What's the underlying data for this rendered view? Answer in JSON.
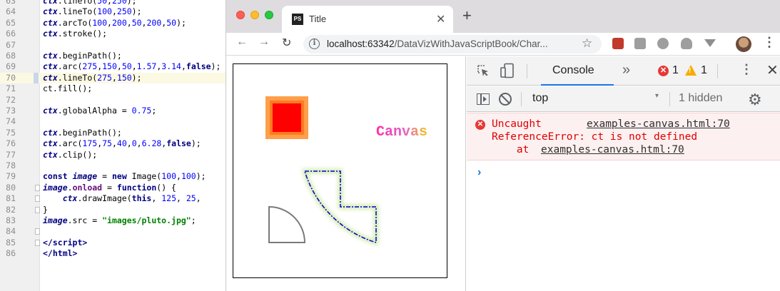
{
  "editor": {
    "lines": [
      {
        "num": "63",
        "html": "<span class='tk-v'>ctx</span>.lineTo(<span class='tk-n'>50</span>,<span class='tk-n'>250</span>);"
      },
      {
        "num": "64",
        "html": "<span class='tk-v'>ctx</span>.lineTo(<span class='tk-n'>100</span>,<span class='tk-n'>250</span>);"
      },
      {
        "num": "65",
        "html": "<span class='tk-v'>ctx</span>.arcTo(<span class='tk-n'>100</span>,<span class='tk-n'>200</span>,<span class='tk-n'>50</span>,<span class='tk-n'>200</span>,<span class='tk-n'>50</span>);"
      },
      {
        "num": "66",
        "html": "<span class='tk-v'>ctx</span>.stroke();"
      },
      {
        "num": "67",
        "html": ""
      },
      {
        "num": "68",
        "html": "<span class='tk-v'>ctx</span>.beginPath();"
      },
      {
        "num": "69",
        "html": "<span class='tk-v'>ctx</span>.arc(<span class='tk-n'>275</span>,<span class='tk-n'>150</span>,<span class='tk-n'>50</span>,<span class='tk-n'>1.57</span>,<span class='tk-n'>3.14</span>,<span class='tk-k'>false</span>);"
      },
      {
        "num": "70",
        "html": "<span class='tk-v'>ctx</span>.lineTo(<span class='tk-n'>275</span>,<span class='tk-n'>150</span>);"
      },
      {
        "num": "71",
        "html": "ct.fill();"
      },
      {
        "num": "72",
        "html": ""
      },
      {
        "num": "73",
        "html": "<span class='tk-v'>ctx</span>.globalAlpha = <span class='tk-n'>0.75</span>;"
      },
      {
        "num": "74",
        "html": ""
      },
      {
        "num": "75",
        "html": "<span class='tk-v'>ctx</span>.beginPath();"
      },
      {
        "num": "76",
        "html": "<span class='tk-v'>ctx</span>.arc(<span class='tk-n'>175</span>,<span class='tk-n'>75</span>,<span class='tk-n'>40</span>,<span class='tk-n'>0</span>,<span class='tk-n'>6.28</span>,<span class='tk-k'>false</span>);"
      },
      {
        "num": "77",
        "html": "<span class='tk-v'>ctx</span>.clip();"
      },
      {
        "num": "78",
        "html": ""
      },
      {
        "num": "79",
        "html": "<span class='tk-k'>const</span> <span class='tk-v'>image</span> = <span class='tk-k'>new</span> Image(<span class='tk-n'>100</span>,<span class='tk-n'>100</span>);"
      },
      {
        "num": "80",
        "html": "<span class='tk-v'>image</span>.<span class='tk-m'>onload</span> = <span class='tk-k'>function</span>() {"
      },
      {
        "num": "81",
        "html": "    <span class='tk-v'>ctx</span>.drawImage(<span class='tk-k'>this</span>, <span class='tk-n'>125</span>, <span class='tk-n'>25</span>,"
      },
      {
        "num": "82",
        "html": "}"
      },
      {
        "num": "83",
        "html": "<span class='tk-v'>image</span>.src = <span class='tk-s'>\"images/pluto.jpg\"</span>;"
      },
      {
        "num": "84",
        "html": ""
      },
      {
        "num": "85",
        "html": "<span class='tk-t'>&lt;/script&gt;</span>"
      },
      {
        "num": "86",
        "html": "<span class='tk-t'>&lt;/html&gt;</span>"
      }
    ]
  },
  "browser": {
    "tab_title": "Title",
    "tab_favicon": "PS",
    "url_host": "localhost:63342",
    "url_path": "/DataVizWithJavaScriptBook/Char...",
    "canvas_text": "Canvas"
  },
  "devtools": {
    "active_tab": "Console",
    "error_count": "1",
    "warning_count": "1",
    "context": "top",
    "hidden": "1 hidden",
    "error": {
      "title": "Uncaught",
      "source": "examples-canvas.html:70",
      "message": "ReferenceError: ct is not defined",
      "stack_prefix": "    at ",
      "stack_link": "examples-canvas.html:70"
    }
  },
  "colors": {
    "error_red": "#e00000",
    "console_accent": "#1a73e8",
    "square_outer": "#ff9f4a",
    "square_inner": "#ff0000",
    "dash_stroke": "#0000cc"
  }
}
